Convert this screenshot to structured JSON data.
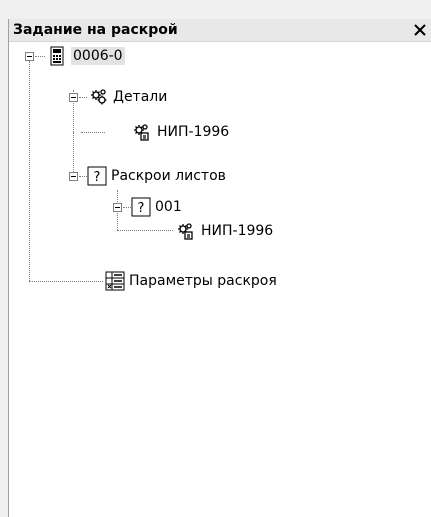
{
  "panel": {
    "title": "Задание на раскрой"
  },
  "tree": {
    "root": "0006-0",
    "details": "Детали",
    "detail_item": "НИП-1996",
    "sheet_cuts": "Раскрои листов",
    "sheet_001": "001",
    "sheet_001_item": "НИП-1996",
    "cut_params": "Параметры раскроя"
  },
  "icons": {
    "close": "close-icon",
    "root": "calculator-icon",
    "details": "gear-icon",
    "part": "part-gear-icon",
    "unknown": "question-box-icon",
    "params": "params-table-icon"
  }
}
